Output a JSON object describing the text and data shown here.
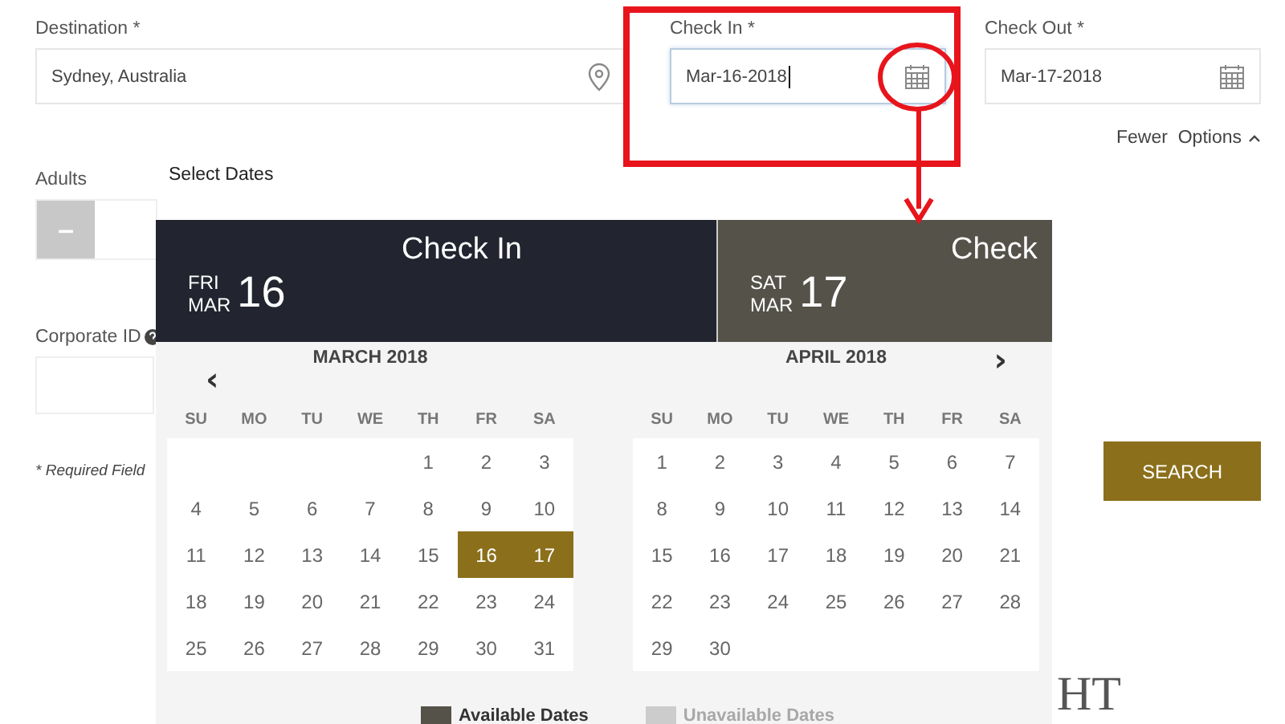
{
  "form": {
    "destination": {
      "label": "Destination *",
      "value": "Sydney, Australia"
    },
    "check_in": {
      "label": "Check In *",
      "value": "Mar-16-2018",
      "focused": true
    },
    "check_out": {
      "label": "Check Out *",
      "value": "Mar-17-2018",
      "focused": false
    },
    "options_toggle": {
      "label": "Fewer  Options",
      "expanded": true
    },
    "adults": {
      "label": "Adults",
      "decrement": "–"
    },
    "corporate_id": {
      "label": "Corporate ID"
    },
    "required_note": "* Required Field",
    "search_button": "SEARCH"
  },
  "date_picker": {
    "title": "Select Dates",
    "panels": [
      {
        "title": "Check In",
        "weekday": "FRI",
        "month": "MAR",
        "day": "16",
        "selected": true
      },
      {
        "title": "Check",
        "weekday": "SAT",
        "month": "MAR",
        "day": "17",
        "selected": false
      }
    ],
    "months": [
      {
        "title": "MARCH 2018",
        "nav": "‹",
        "weekdays": [
          "SU",
          "MO",
          "TU",
          "WE",
          "TH",
          "FR",
          "SA"
        ],
        "weeks": [
          [
            {
              "kind": "blank"
            },
            {
              "kind": "blank"
            },
            {
              "kind": "blank"
            },
            {
              "kind": "blank"
            },
            {
              "kind": "day",
              "day": "1",
              "selected": false
            },
            {
              "kind": "day",
              "day": "2",
              "selected": false
            },
            {
              "kind": "day",
              "day": "3",
              "selected": false
            }
          ],
          [
            {
              "kind": "day",
              "day": "4",
              "selected": false
            },
            {
              "kind": "day",
              "day": "5",
              "selected": false
            },
            {
              "kind": "day",
              "day": "6",
              "selected": false
            },
            {
              "kind": "day",
              "day": "7",
              "selected": false
            },
            {
              "kind": "day",
              "day": "8",
              "selected": false
            },
            {
              "kind": "day",
              "day": "9",
              "selected": false
            },
            {
              "kind": "day",
              "day": "10",
              "selected": false
            }
          ],
          [
            {
              "kind": "day",
              "day": "11",
              "selected": false
            },
            {
              "kind": "day",
              "day": "12",
              "selected": false
            },
            {
              "kind": "day",
              "day": "13",
              "selected": false
            },
            {
              "kind": "day",
              "day": "14",
              "selected": false
            },
            {
              "kind": "day",
              "day": "15",
              "selected": false
            },
            {
              "kind": "day",
              "day": "16",
              "selected": true
            },
            {
              "kind": "day",
              "day": "17",
              "selected": true
            }
          ],
          [
            {
              "kind": "day",
              "day": "18",
              "selected": false
            },
            {
              "kind": "day",
              "day": "19",
              "selected": false
            },
            {
              "kind": "day",
              "day": "20",
              "selected": false
            },
            {
              "kind": "day",
              "day": "21",
              "selected": false
            },
            {
              "kind": "day",
              "day": "22",
              "selected": false
            },
            {
              "kind": "day",
              "day": "23",
              "selected": false
            },
            {
              "kind": "day",
              "day": "24",
              "selected": false
            }
          ],
          [
            {
              "kind": "day",
              "day": "25",
              "selected": false
            },
            {
              "kind": "day",
              "day": "26",
              "selected": false
            },
            {
              "kind": "day",
              "day": "27",
              "selected": false
            },
            {
              "kind": "day",
              "day": "28",
              "selected": false
            },
            {
              "kind": "day",
              "day": "29",
              "selected": false
            },
            {
              "kind": "day",
              "day": "30",
              "selected": false
            },
            {
              "kind": "day",
              "day": "31",
              "selected": false
            }
          ]
        ]
      },
      {
        "title": "APRIL 2018",
        "nav": "›",
        "weekdays": [
          "SU",
          "MO",
          "TU",
          "WE",
          "TH",
          "FR",
          "SA"
        ],
        "weeks": [
          [
            {
              "kind": "day",
              "day": "1",
              "selected": false
            },
            {
              "kind": "day",
              "day": "2",
              "selected": false
            },
            {
              "kind": "day",
              "day": "3",
              "selected": false
            },
            {
              "kind": "day",
              "day": "4",
              "selected": false
            },
            {
              "kind": "day",
              "day": "5",
              "selected": false
            },
            {
              "kind": "day",
              "day": "6",
              "selected": false
            },
            {
              "kind": "day",
              "day": "7",
              "selected": false
            }
          ],
          [
            {
              "kind": "day",
              "day": "8",
              "selected": false
            },
            {
              "kind": "day",
              "day": "9",
              "selected": false
            },
            {
              "kind": "day",
              "day": "10",
              "selected": false
            },
            {
              "kind": "day",
              "day": "11",
              "selected": false
            },
            {
              "kind": "day",
              "day": "12",
              "selected": false
            },
            {
              "kind": "day",
              "day": "13",
              "selected": false
            },
            {
              "kind": "day",
              "day": "14",
              "selected": false
            }
          ],
          [
            {
              "kind": "day",
              "day": "15",
              "selected": false
            },
            {
              "kind": "day",
              "day": "16",
              "selected": false
            },
            {
              "kind": "day",
              "day": "17",
              "selected": false
            },
            {
              "kind": "day",
              "day": "18",
              "selected": false
            },
            {
              "kind": "day",
              "day": "19",
              "selected": false
            },
            {
              "kind": "day",
              "day": "20",
              "selected": false
            },
            {
              "kind": "day",
              "day": "21",
              "selected": false
            }
          ],
          [
            {
              "kind": "day",
              "day": "22",
              "selected": false
            },
            {
              "kind": "day",
              "day": "23",
              "selected": false
            },
            {
              "kind": "day",
              "day": "24",
              "selected": false
            },
            {
              "kind": "day",
              "day": "25",
              "selected": false
            },
            {
              "kind": "day",
              "day": "26",
              "selected": false
            },
            {
              "kind": "day",
              "day": "27",
              "selected": false
            },
            {
              "kind": "day",
              "day": "28",
              "selected": false
            }
          ],
          [
            {
              "kind": "day",
              "day": "29",
              "selected": false
            },
            {
              "kind": "day",
              "day": "30",
              "selected": false
            }
          ]
        ]
      }
    ],
    "legend": [
      {
        "label": "Available Dates",
        "available": true
      },
      {
        "label": "Unavailable Dates",
        "available": false
      }
    ]
  },
  "logo_fragment": "HT"
}
